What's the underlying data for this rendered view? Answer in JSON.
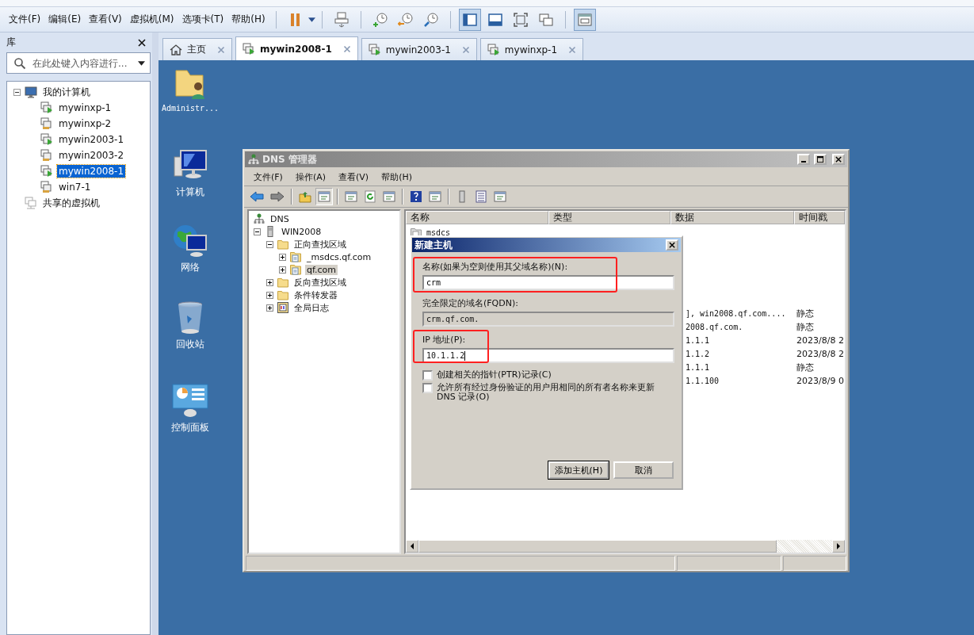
{
  "menu_bar": {
    "items": [
      "文件(F)",
      "编辑(E)",
      "查看(V)",
      "虚拟机(M)",
      "选项卡(T)",
      "帮助(H)"
    ]
  },
  "toolbar": {
    "view_buttons": [
      {
        "selected": true
      },
      {
        "selected": false
      },
      {
        "selected": false
      },
      {
        "selected": false
      }
    ],
    "tab_view_selected": true
  },
  "library": {
    "title": "库",
    "search": {
      "placeholder": "在此处键入内容进行..."
    },
    "tree": [
      {
        "label": "我的计算机",
        "kind": "folder",
        "expanded": true,
        "selected": false,
        "children": [
          {
            "label": "mywinxp-1",
            "kind": "vm",
            "running": true,
            "selected": false
          },
          {
            "label": "mywinxp-2",
            "kind": "vm",
            "running": false,
            "selected": false
          },
          {
            "label": "mywin2003-1",
            "kind": "vm",
            "running": true,
            "selected": false
          },
          {
            "label": "mywin2003-2",
            "kind": "vm",
            "running": false,
            "selected": false
          },
          {
            "label": "mywin2008-1",
            "kind": "vm",
            "running": true,
            "selected": true
          },
          {
            "label": "win7-1",
            "kind": "vm",
            "running": false,
            "selected": false
          }
        ]
      },
      {
        "label": "共享的虚拟机",
        "kind": "shared",
        "selected": false
      }
    ]
  },
  "tabs": [
    {
      "label": "主页",
      "kind": "home",
      "selected": false
    },
    {
      "label": "mywin2008-1",
      "kind": "vm",
      "selected": true
    },
    {
      "label": "mywin2003-1",
      "kind": "vm",
      "selected": false
    },
    {
      "label": "mywinxp-1",
      "kind": "vm",
      "selected": false
    }
  ],
  "desktop_icons": [
    {
      "label": "Administr...",
      "kind": "user-folder"
    },
    {
      "label": "计算机",
      "kind": "computer"
    },
    {
      "label": "网络",
      "kind": "network"
    },
    {
      "label": "回收站",
      "kind": "recycle"
    },
    {
      "label": "控制面板",
      "kind": "control-panel"
    }
  ],
  "dns_window": {
    "title": "DNS 管理器",
    "menu": [
      "文件(F)",
      "操作(A)",
      "查看(V)",
      "帮助(H)"
    ],
    "tree": [
      {
        "label": "DNS",
        "kind": "dns",
        "selected": false,
        "children": [
          {
            "label": "WIN2008",
            "kind": "server",
            "expanded": true,
            "selected": false,
            "children": [
              {
                "label": "正向查找区域",
                "kind": "folder",
                "expanded": true,
                "selected": false,
                "children": [
                  {
                    "label": "_msdcs.qf.com",
                    "kind": "zone",
                    "expanded": false,
                    "selected": false
                  },
                  {
                    "label": "qf.com",
                    "kind": "zone",
                    "expanded": false,
                    "selected": true
                  }
                ]
              },
              {
                "label": "反向查找区域",
                "kind": "folder",
                "expanded": false,
                "selected": false
              },
              {
                "label": "条件转发器",
                "kind": "folder",
                "expanded": false,
                "selected": false
              },
              {
                "label": "全局日志",
                "kind": "log",
                "expanded": false,
                "selected": false
              }
            ]
          }
        ]
      }
    ],
    "list": {
      "columns": [
        "名称",
        "类型",
        "数据",
        "时间戳"
      ],
      "rows": [
        {
          "name": "msdcs"
        },
        {
          "data": "], win2008.qf.com....",
          "timestamp": "静态"
        },
        {
          "data": "2008.qf.com.",
          "timestamp": "静态"
        },
        {
          "data": "1.1.1",
          "timestamp": "2023/8/8 2"
        },
        {
          "data": "1.1.2",
          "timestamp": "2023/8/8 2"
        },
        {
          "data": "1.1.1",
          "timestamp": "静态"
        },
        {
          "data": "1.1.100",
          "timestamp": "2023/8/9 0"
        }
      ]
    }
  },
  "dialog": {
    "title": "新建主机",
    "name_field": {
      "label": "名称(如果为空则使用其父域名称)(N):",
      "value": "crm",
      "highlighted": true
    },
    "fqdn_field": {
      "label": "完全限定的域名(FQDN):",
      "value": "crm.qf.com."
    },
    "ip_field": {
      "label": "IP 地址(P):",
      "value": "10.1.1.2",
      "highlighted": true
    },
    "checkboxes": [
      {
        "label": "创建相关的指针(PTR)记录(C)",
        "checked": false
      },
      {
        "label": "允许所有经过身份验证的用户用相同的所有者名称来更新 DNS 记录(O)",
        "checked": false
      }
    ],
    "buttons": [
      {
        "label": "添加主机(H)",
        "default": true
      },
      {
        "label": "取消",
        "default": false
      }
    ]
  }
}
